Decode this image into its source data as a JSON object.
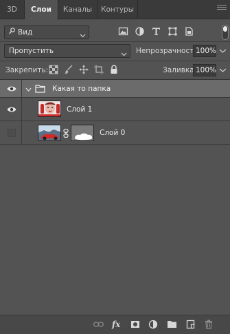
{
  "tabs": [
    {
      "label": "3D",
      "active": false
    },
    {
      "label": "Слои",
      "active": true
    },
    {
      "label": "Каналы",
      "active": false
    },
    {
      "label": "Контуры",
      "active": false
    }
  ],
  "filter": {
    "label": "Вид",
    "icon": "search-icon"
  },
  "filter_icons": [
    "image-filter-icon",
    "adjustment-filter-icon",
    "type-filter-icon",
    "shape-filter-icon",
    "smart-object-filter-icon"
  ],
  "blend": {
    "value": "Пропустить"
  },
  "opacity": {
    "label": "Непрозрачность:",
    "value": "100%"
  },
  "lock": {
    "label": "Закрепить:",
    "icons": [
      "lock-transparent-icon",
      "lock-brush-icon",
      "lock-position-icon",
      "lock-artboard-icon",
      "lock-all-icon"
    ]
  },
  "fill": {
    "label": "Заливка:",
    "value": "100%"
  },
  "layers": [
    {
      "type": "group",
      "name": "Какая то папка",
      "visible": true,
      "expanded": true
    },
    {
      "type": "layer",
      "name": "Слой 1",
      "visible": true
    },
    {
      "type": "layer",
      "name": "Слой 0",
      "visible": false,
      "has_mask": true
    }
  ],
  "bottom_icons": [
    "link-layers-icon",
    "fx-icon",
    "add-mask-icon",
    "adjustment-layer-icon",
    "new-group-icon",
    "new-layer-icon",
    "delete-layer-icon"
  ],
  "bottom": {
    "fx": "fx"
  },
  "colors": {
    "panel": "#535353",
    "tabbar": "#3a3a3a",
    "selected": "#6b6b6b"
  }
}
